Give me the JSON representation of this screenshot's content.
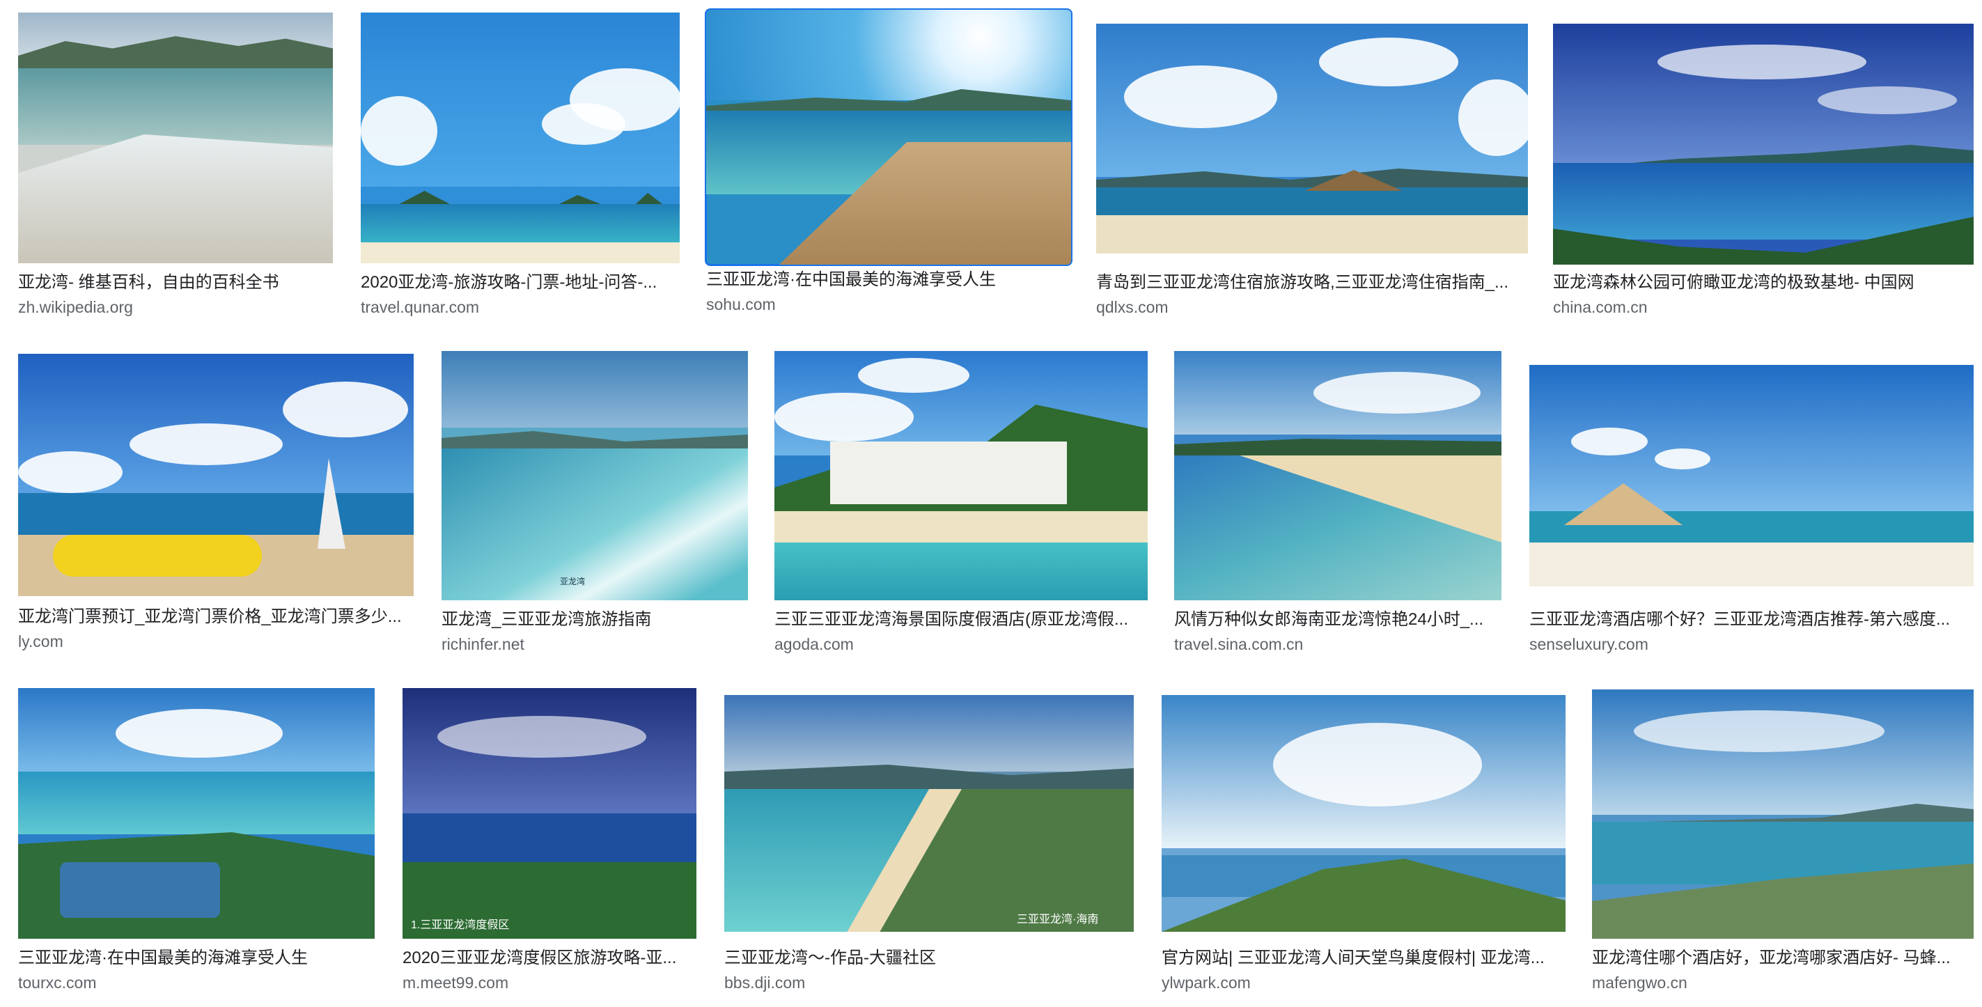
{
  "results": [
    {
      "title": "亚龙湾- 维基百科，自由的百科全书",
      "domain": "zh.wikipedia.org"
    },
    {
      "title": "2020亚龙湾-旅游攻略-门票-地址-问答-...",
      "domain": "travel.qunar.com"
    },
    {
      "title": "三亚亚龙湾·在中国最美的海滩享受人生",
      "domain": "sohu.com"
    },
    {
      "title": "青岛到三亚亚龙湾住宿旅游攻略,三亚亚龙湾住宿指南_...",
      "domain": "qdlxs.com"
    },
    {
      "title": "亚龙湾森林公园可俯瞰亚龙湾的极致基地- 中国网",
      "domain": "china.com.cn"
    },
    {
      "title": "亚龙湾门票预订_亚龙湾门票价格_亚龙湾门票多少...",
      "domain": "ly.com"
    },
    {
      "title": "亚龙湾_三亚亚龙湾旅游指南",
      "domain": "richinfer.net"
    },
    {
      "title": "三亚三亚亚龙湾海景国际度假酒店(原亚龙湾假...",
      "domain": "agoda.com"
    },
    {
      "title": "风情万种似女郎海南亚龙湾惊艳24小时_...",
      "domain": "travel.sina.com.cn"
    },
    {
      "title": "三亚亚龙湾酒店哪个好？三亚亚龙湾酒店推荐-第六感度...",
      "domain": "senseluxury.com"
    },
    {
      "title": "三亚亚龙湾·在中国最美的海滩享受人生",
      "domain": "tourxc.com"
    },
    {
      "title": "2020三亚亚龙湾度假区旅游攻略-亚...",
      "domain": "m.meet99.com"
    },
    {
      "title": "三亚亚龙湾～-作品-大疆社区",
      "domain": "bbs.dji.com"
    },
    {
      "title": "官方网站| 三亚亚龙湾人间天堂鸟巢度假村| 亚龙湾...",
      "domain": "ylwpark.com"
    },
    {
      "title": "亚龙湾住哪个酒店好，亚龙湾哪家酒店好- 马蜂...",
      "domain": "mafengwo.cn"
    }
  ],
  "overlays": {
    "img12_caption": "1.三亚亚龙湾度假区",
    "img7_caption": "亚龙湾",
    "img13_caption": "三亚亚龙湾·海南"
  },
  "colors": {
    "selected_outline": "#1a73e8",
    "title_text": "#202124",
    "domain_text": "#5f6368"
  }
}
